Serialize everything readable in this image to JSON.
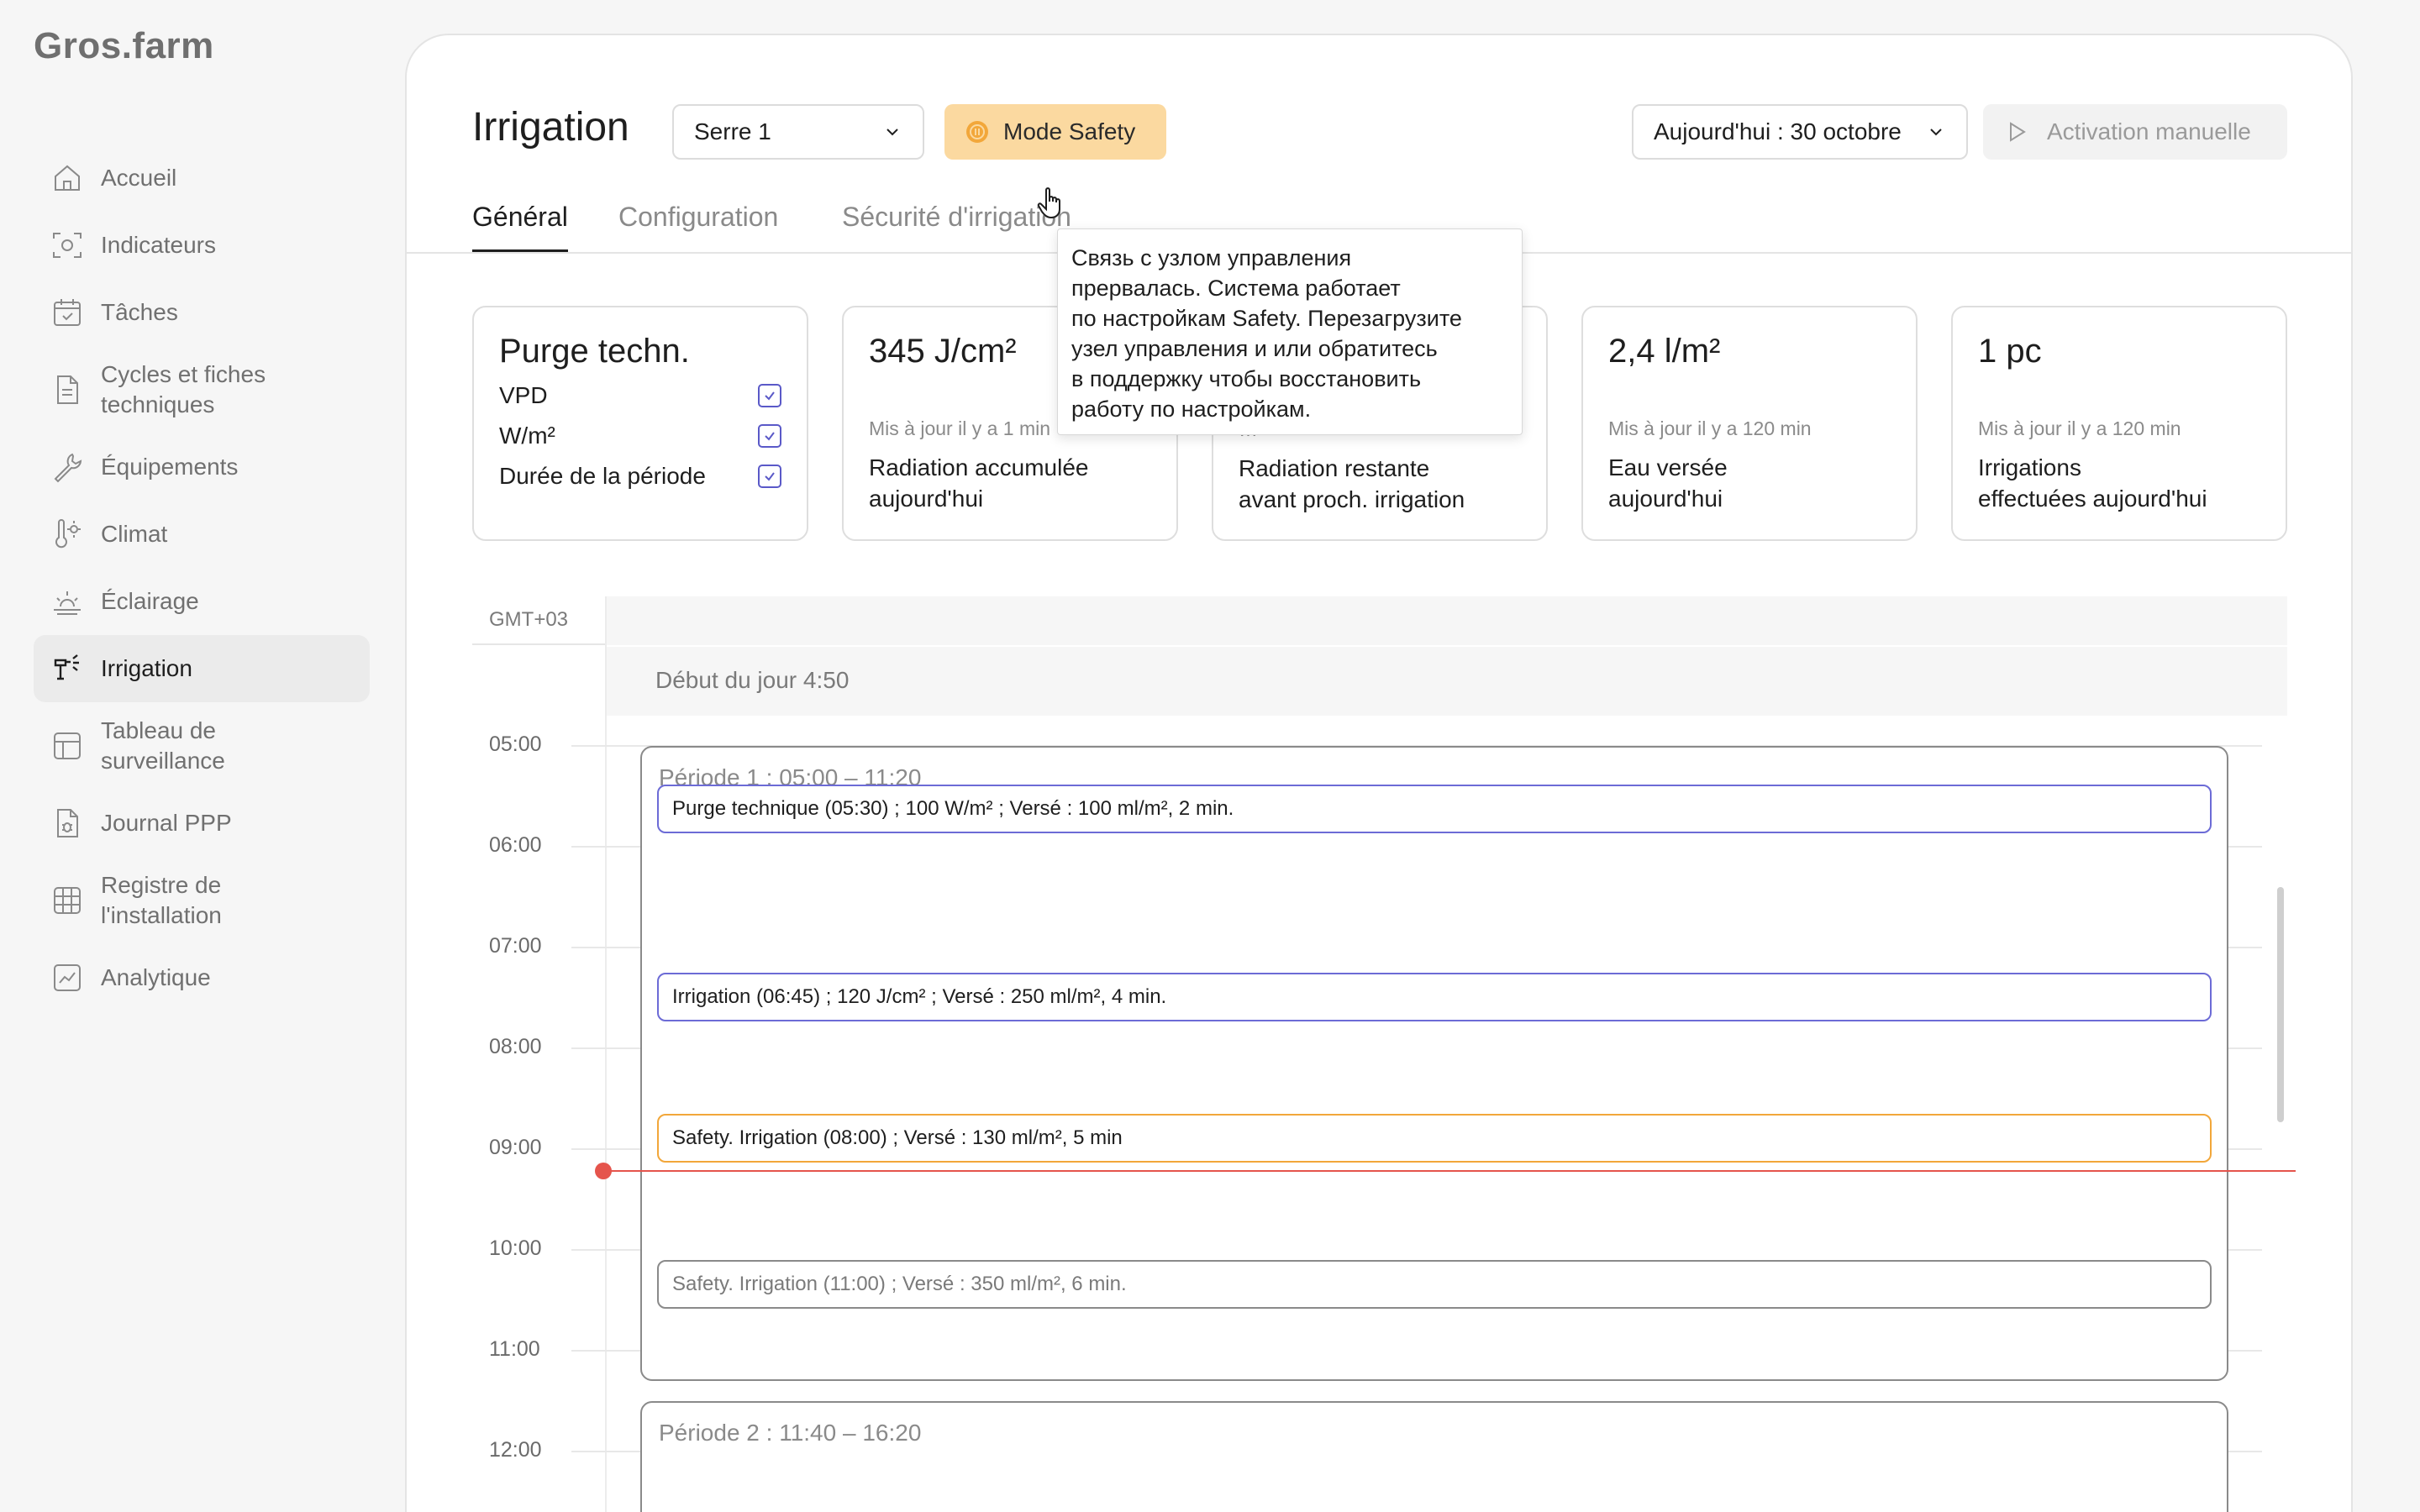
{
  "app": {
    "logo": "Gros.farm"
  },
  "sidebar": {
    "items": [
      {
        "label": "Accueil",
        "icon": "home-icon"
      },
      {
        "label": "Indicateurs",
        "icon": "camera-icon"
      },
      {
        "label": "Tâches",
        "icon": "calendar-check-icon"
      },
      {
        "label": "Cycles et fiches techniques",
        "icon": "document-icon"
      },
      {
        "label": "Équipements",
        "icon": "wrench-icon"
      },
      {
        "label": "Climat",
        "icon": "thermometer-icon"
      },
      {
        "label": "Éclairage",
        "icon": "sunrise-icon"
      },
      {
        "label": "Irrigation",
        "icon": "sprinkler-icon",
        "active": true
      },
      {
        "label": "Tableau de surveillance",
        "icon": "layout-icon"
      },
      {
        "label": "Journal PPP",
        "icon": "bug-document-icon"
      },
      {
        "label": "Registre de l'installation",
        "icon": "grid-icon"
      },
      {
        "label": "Analytique",
        "icon": "chart-icon"
      }
    ]
  },
  "header": {
    "title": "Irrigation",
    "greenhouse_select": "Serre 1",
    "safety_mode": "Mode Safety",
    "date_select": "Aujourd'hui : 30 octobre",
    "manual_activation": "Activation manuelle"
  },
  "tabs": [
    {
      "label": "Général",
      "active": true
    },
    {
      "label": "Configuration"
    },
    {
      "label": "Sécurité d'irrigation"
    }
  ],
  "tooltip": {
    "text_lines": [
      "Связь с узлом управления",
      "прервалась. Система работает",
      "по настройкам Safety. Перезагрузите",
      "узел управления и или обратитесь",
      "в поддержку чтобы восстановить",
      "работу по настройкам."
    ]
  },
  "cards": {
    "purge": {
      "title": "Purge techn.",
      "checks": [
        {
          "label": "VPD",
          "checked": true
        },
        {
          "label": "W/m²",
          "checked": true
        },
        {
          "label": "Durée de la période",
          "checked": true
        }
      ]
    },
    "radiation": {
      "value": "345 J/cm²",
      "updated": "Mis à jour il y a 1 min",
      "label_line1": "Radiation accumulée",
      "label_line2": "aujourd'hui"
    },
    "remaining": {
      "value": "",
      "updated": "…",
      "label_line1": "Radiation restante",
      "label_line2": "avant proch. irrigation"
    },
    "water": {
      "value": "2,4 l/m²",
      "updated": "Mis à jour il y a 120 min",
      "label_line1": "Eau versée",
      "label_line2": "aujourd'hui"
    },
    "irrigations": {
      "value": "1 pc",
      "updated": "Mis à jour il y a 120 min",
      "label_line1": "Irrigations",
      "label_line2": "effectuées aujourd'hui"
    }
  },
  "timeline": {
    "timezone": "GMT+03",
    "day_start": "Début du jour 4:50",
    "hours": [
      "05:00",
      "06:00",
      "07:00",
      "08:00",
      "09:00",
      "10:00",
      "11:00",
      "12:00"
    ],
    "periods": [
      {
        "title": "Période 1 : 05:00 – 11:20"
      },
      {
        "title": "Période 2 : 11:40 – 16:20"
      }
    ],
    "events": [
      {
        "text": "Purge technique (05:30) ; 100 W/m² ; Versé : 100 ml/m², 2 min.",
        "status": "planned",
        "color": "#6c6bd6"
      },
      {
        "text": "Irrigation (06:45) ; 120 J/cm² ; Versé : 250 ml/m², 4 min.",
        "status": "planned",
        "color": "#6c6bd6"
      },
      {
        "text": "Safety. Irrigation (08:00) ; Versé : 130 ml/m², 5 min",
        "status": "safety",
        "color": "#f2a73a"
      },
      {
        "text": "Safety. Irrigation (11:00) ; Versé : 350 ml/m², 6 min.",
        "status": "future",
        "color": "#8a8a8a"
      }
    ]
  }
}
